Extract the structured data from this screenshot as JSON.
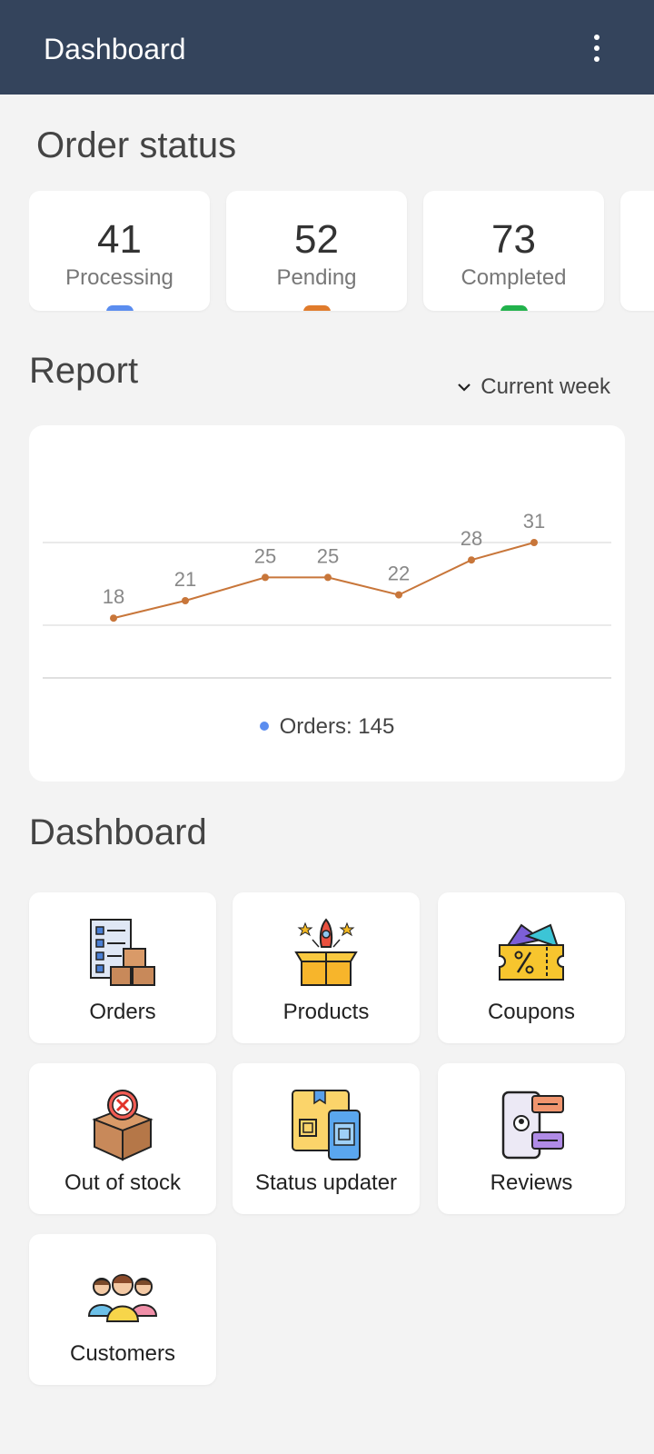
{
  "appbar": {
    "title": "Dashboard",
    "menu_icon": "more-vert-icon"
  },
  "order_status": {
    "title": "Order status",
    "cards": [
      {
        "value": "41",
        "label": "Processing",
        "color": "#5b8def"
      },
      {
        "value": "52",
        "label": "Pending",
        "color": "#e07b2c"
      },
      {
        "value": "73",
        "label": "Completed",
        "color": "#22b24c"
      }
    ]
  },
  "report": {
    "title": "Report",
    "range_label": "Current week",
    "legend_label": "Orders: 145",
    "legend_color": "#5b8def",
    "line_color": "#c8763a"
  },
  "chart_data": {
    "type": "line",
    "values": [
      18,
      21,
      25,
      25,
      22,
      28,
      31
    ],
    "data_labels": [
      "18",
      "21",
      "25",
      "25",
      "22",
      "28",
      "31"
    ],
    "grid": true,
    "series": [
      {
        "name": "Orders",
        "values": [
          18,
          21,
          25,
          25,
          22,
          28,
          31
        ]
      }
    ]
  },
  "dashboard": {
    "title": "Dashboard",
    "tiles": [
      {
        "label": "Orders",
        "icon": "orders-icon"
      },
      {
        "label": "Products",
        "icon": "products-icon"
      },
      {
        "label": "Coupons",
        "icon": "coupons-icon"
      },
      {
        "label": "Out of stock",
        "icon": "out-of-stock-icon"
      },
      {
        "label": "Status updater",
        "icon": "status-updater-icon"
      },
      {
        "label": "Reviews",
        "icon": "reviews-icon"
      },
      {
        "label": "Customers",
        "icon": "customers-icon"
      }
    ]
  }
}
